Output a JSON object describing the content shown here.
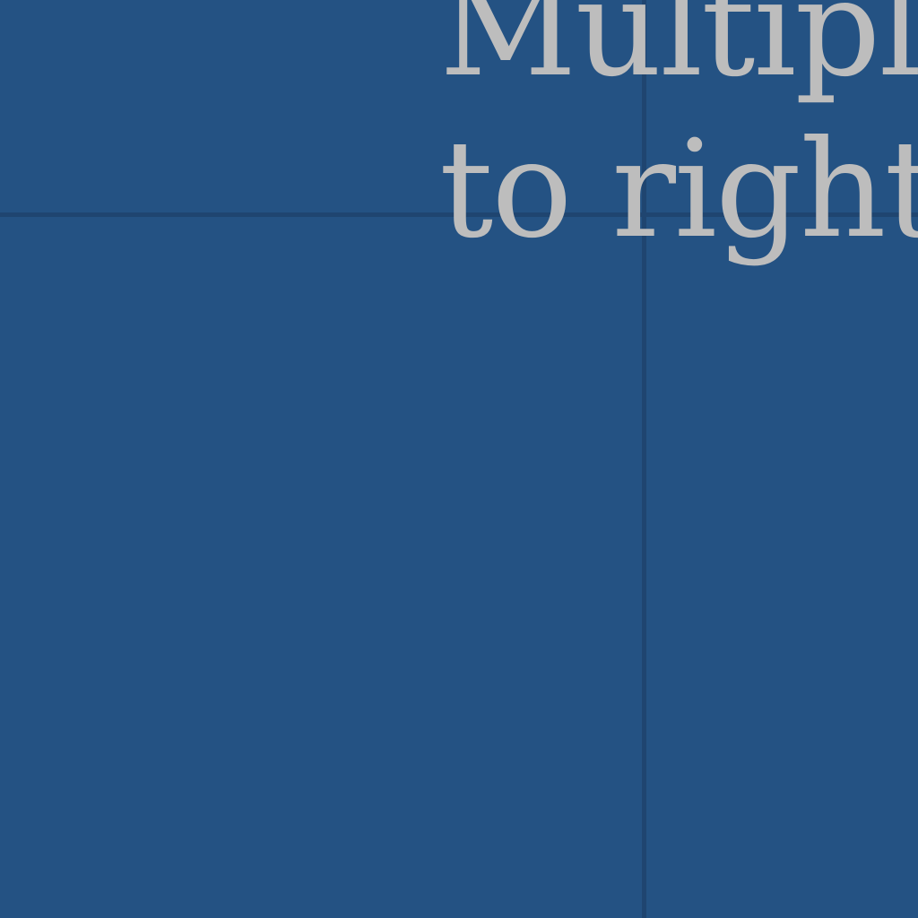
{
  "heading": {
    "line1": "Multiple",
    "line2": "to right f"
  },
  "colors": {
    "background": "#245283",
    "grid_line": "#1f4570",
    "text": "#bdbdbd"
  }
}
